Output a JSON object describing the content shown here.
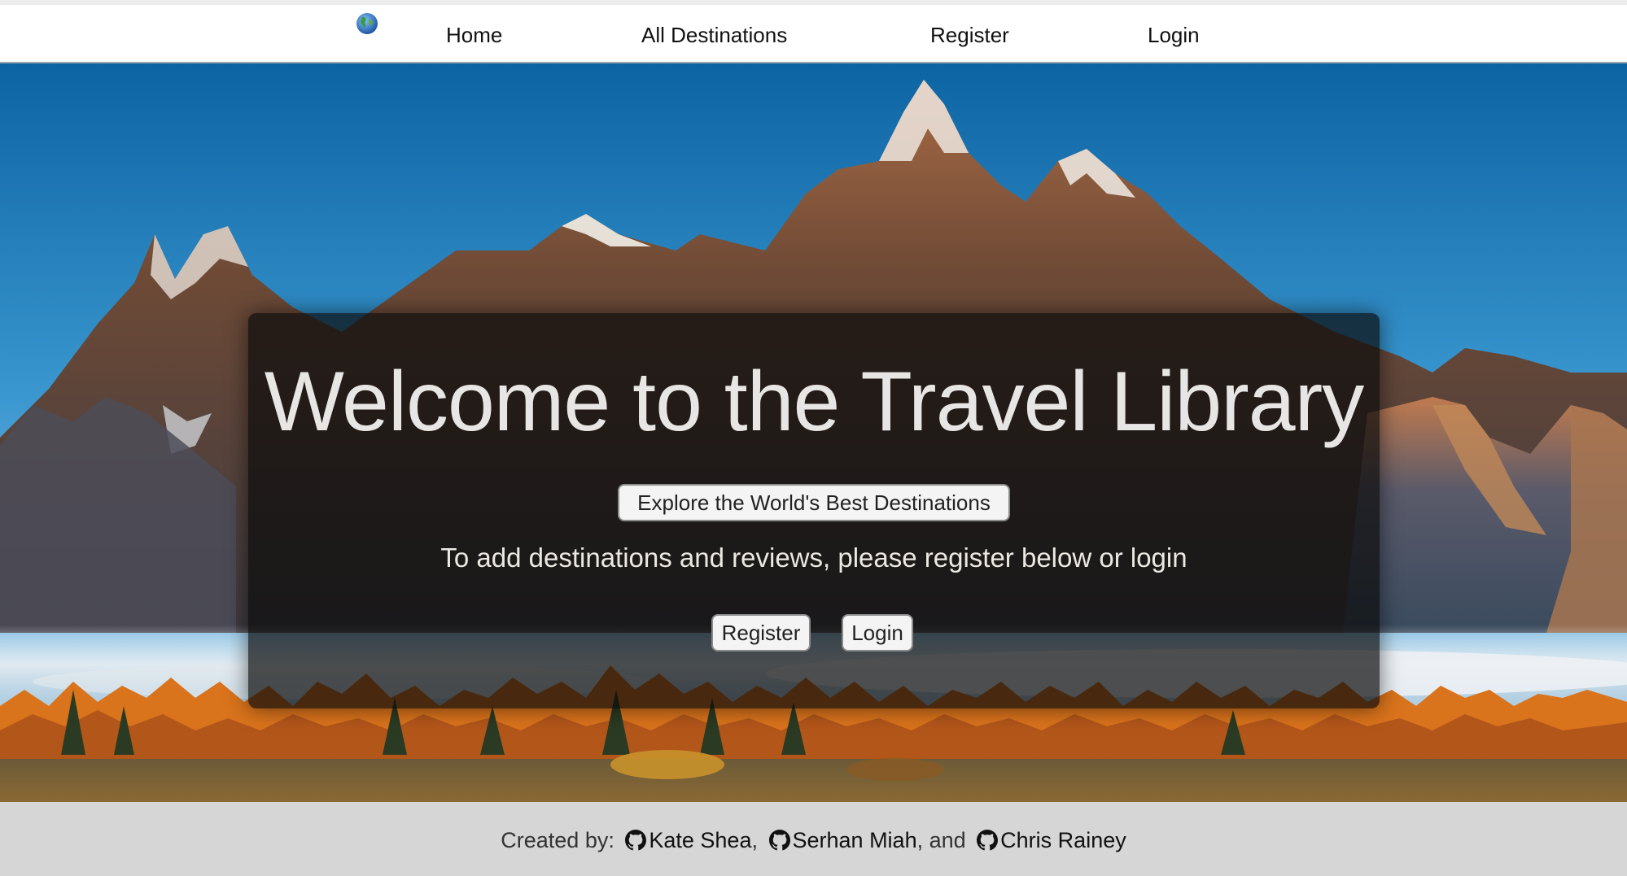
{
  "nav": {
    "logo_icon": "globe-icon",
    "links": [
      "Home",
      "All Destinations",
      "Register",
      "Login"
    ]
  },
  "hero": {
    "title": "Welcome to the Travel Library",
    "explore_button": "Explore the World's Best Destinations",
    "subtext": "To add destinations and reviews, please register below or login",
    "register_button": "Register",
    "login_button": "Login"
  },
  "footer": {
    "prefix": "Created by:",
    "authors": [
      "Kate Shea",
      "Serhan Miah",
      "Chris Rainey"
    ],
    "sep1": ",",
    "sep2": ", and",
    "author_icon": "github-icon"
  },
  "colors": {
    "sky": "#2c8cc6",
    "card_overlay": "rgba(10,10,10,0.70)",
    "footer_bg": "#d6d6d6",
    "autumn_trees": "#d9731c"
  }
}
